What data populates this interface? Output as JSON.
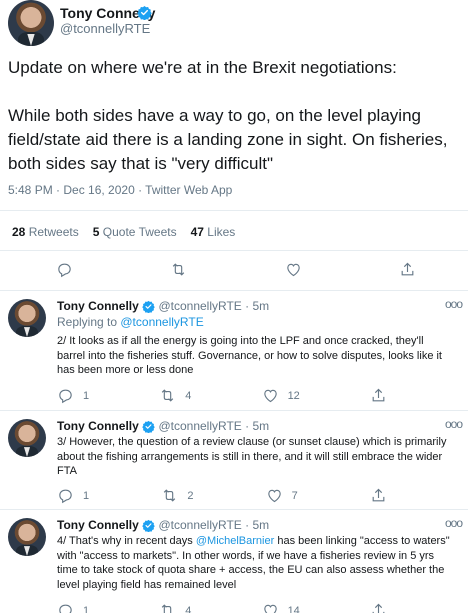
{
  "main": {
    "author_name": "Tony Connelly",
    "author_handle": "@tconnellyRTE",
    "text": "Update on where we're at in the Brexit negotiations:\n\nWhile both sides have a way to go, on the level playing field/state aid there is a landing zone in sight. On fisheries, both sides say that is \"very difficult\"",
    "meta": "5:48 PM · Dec 16, 2020 · Twitter Web App",
    "retweets_count": "28",
    "retweets_label": "Retweets",
    "quotes_count": "5",
    "quotes_label": "Quote Tweets",
    "likes_count": "47",
    "likes_label": "Likes"
  },
  "replies": [
    {
      "author_name": "Tony Connelly",
      "author_handle": "@tconnellyRTE · 5m",
      "replying_prefix": "Replying to ",
      "replying_to": "@tconnellyRTE",
      "text": "2/ It looks as if all the energy is going into the LPF and once cracked, they'll barrel into the fisheries stuff. Governance, or how to solve disputes, looks like it has been more or less done",
      "reply_count": "1",
      "retweet_count": "4",
      "like_count": "12"
    },
    {
      "author_name": "Tony Connelly",
      "author_handle": "@tconnellyRTE · 5m",
      "text": "3/ However, the question of a review clause (or sunset clause) which is primarily about the fishing arrangements is still in there, and it will still embrace the wider FTA",
      "reply_count": "1",
      "retweet_count": "2",
      "like_count": "7"
    },
    {
      "author_name": "Tony Connelly",
      "author_handle": "@tconnellyRTE · 5m",
      "text_before": "4/ That's why in recent days ",
      "mention": "@MichelBarnier",
      "text_after": " has been linking \"access to waters\" with \"access to markets\". In other words, if we have a fisheries review in 5 yrs time to take stock of quota share + access, the EU can also assess whether the level playing field has remained level",
      "reply_count": "1",
      "retweet_count": "4",
      "like_count": "14"
    }
  ],
  "more_label": "ooo",
  "colors": {
    "accent": "#1da1f2",
    "link": "#1b95e0",
    "muted": "#657786",
    "divider": "#e6ecf0"
  },
  "icons": [
    "verified-badge-icon",
    "reply-icon",
    "retweet-icon",
    "like-icon",
    "share-icon",
    "more-icon"
  ]
}
